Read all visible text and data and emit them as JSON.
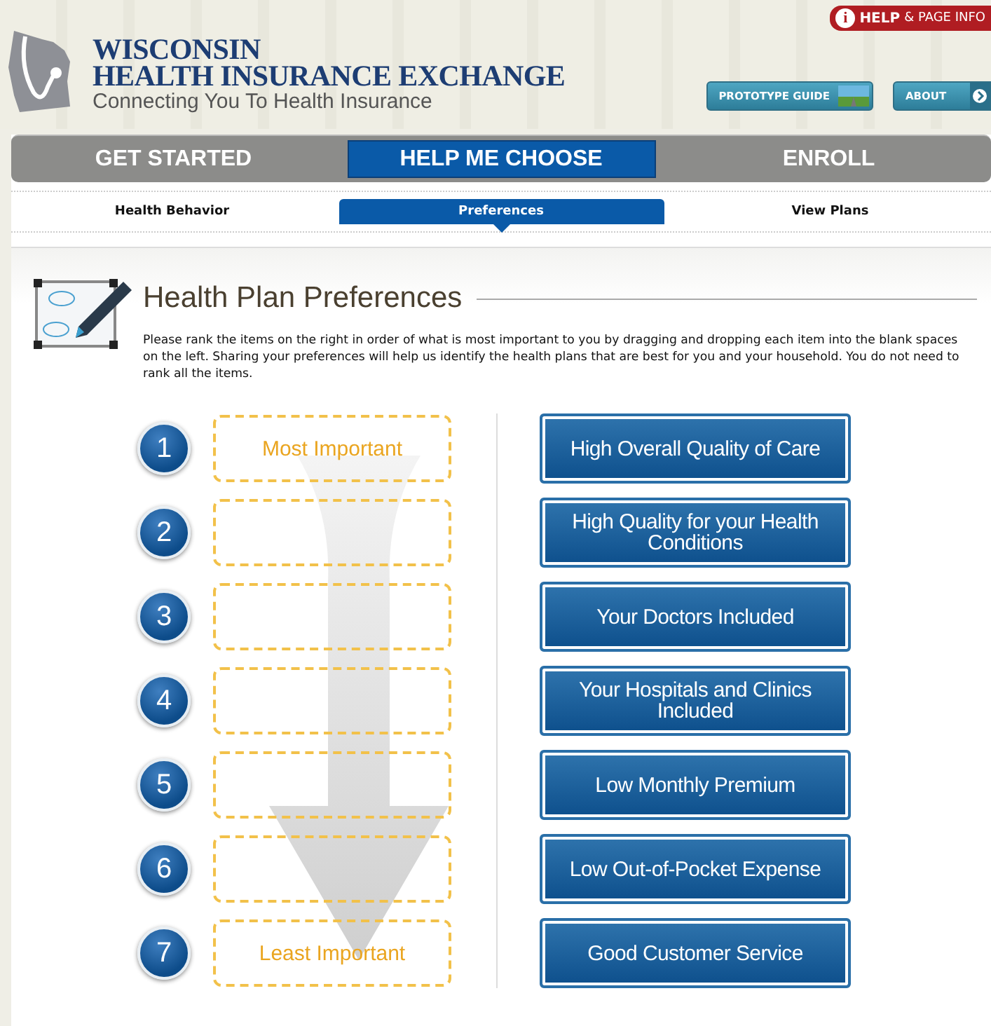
{
  "header": {
    "title_line_1": "WISCONSIN",
    "title_line_2": "HEALTH INSURANCE EXCHANGE",
    "tagline": "Connecting You To Health Insurance",
    "help_link": {
      "icon_text": "i",
      "bold": "HELP",
      "rest": "& PAGE INFO"
    },
    "buttons": [
      "PROTOTYPE GUIDE",
      "ABOUT"
    ]
  },
  "steps": [
    {
      "label": "GET STARTED",
      "selected": false
    },
    {
      "label": "HELP ME CHOOSE",
      "selected": true
    },
    {
      "label": "ENROLL",
      "selected": false
    }
  ],
  "substeps": [
    {
      "label": "Health Behavior",
      "selected": false
    },
    {
      "label": "Preferences",
      "selected": true
    },
    {
      "label": "View Plans",
      "selected": false
    }
  ],
  "section": {
    "title": "Health Plan Preferences",
    "instructions": "Please rank the items on the right in order of what is most important to you by dragging and dropping each item into the blank spaces on the left. Sharing your preferences will help us identify the health plans that are best for you and your household. You do not need to rank all the items."
  },
  "slots": [
    {
      "number": "1",
      "hint": "Most Important"
    },
    {
      "number": "2"
    },
    {
      "number": "3"
    },
    {
      "number": "4"
    },
    {
      "number": "5"
    },
    {
      "number": "6"
    },
    {
      "number": "7",
      "hint": "Least Important"
    }
  ],
  "items": [
    "High Overall Quality of Care",
    "High Quality for your Health Conditions",
    "Your Doctors Included",
    "Your Hospitals and Clinics Included",
    "Low Monthly Premium",
    "Low Out-of-Pocket Expense",
    "Good Customer Service"
  ]
}
